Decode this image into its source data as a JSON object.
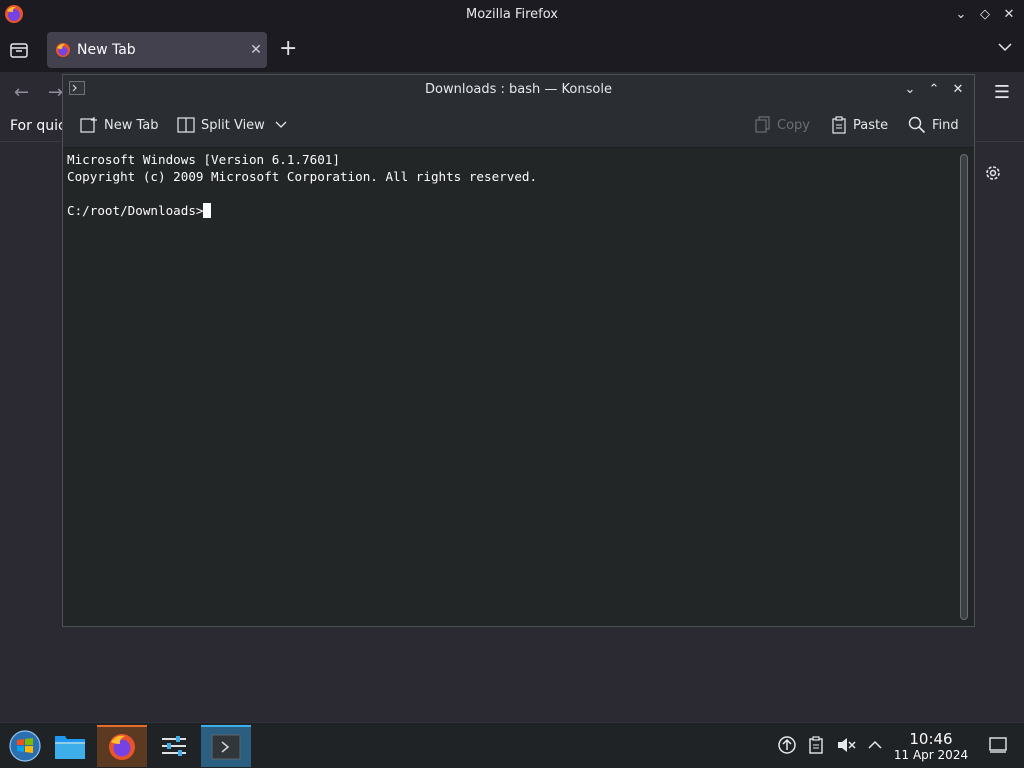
{
  "firefox": {
    "window_title": "Mozilla Firefox",
    "tab_label": "New Tab",
    "bookmark_text": "For quic"
  },
  "konsole": {
    "window_title": "Downloads : bash — Konsole",
    "toolbar": {
      "new_tab": "New Tab",
      "split_view": "Split View",
      "copy": "Copy",
      "paste": "Paste",
      "find": "Find"
    },
    "terminal": {
      "line1": "Microsoft Windows [Version 6.1.7601]",
      "line2": "Copyright (c) 2009 Microsoft Corporation. All rights reserved.",
      "prompt": "C:/root/Downloads>"
    }
  },
  "taskbar": {
    "time": "10:46",
    "date": "11 Apr 2024"
  },
  "colors": {
    "konsole_bg": "#232627",
    "firefox_bg": "#2b2a33",
    "taskbar_active_konsole": "#2a5f82",
    "taskbar_active_firefox": "#5c3a21"
  }
}
